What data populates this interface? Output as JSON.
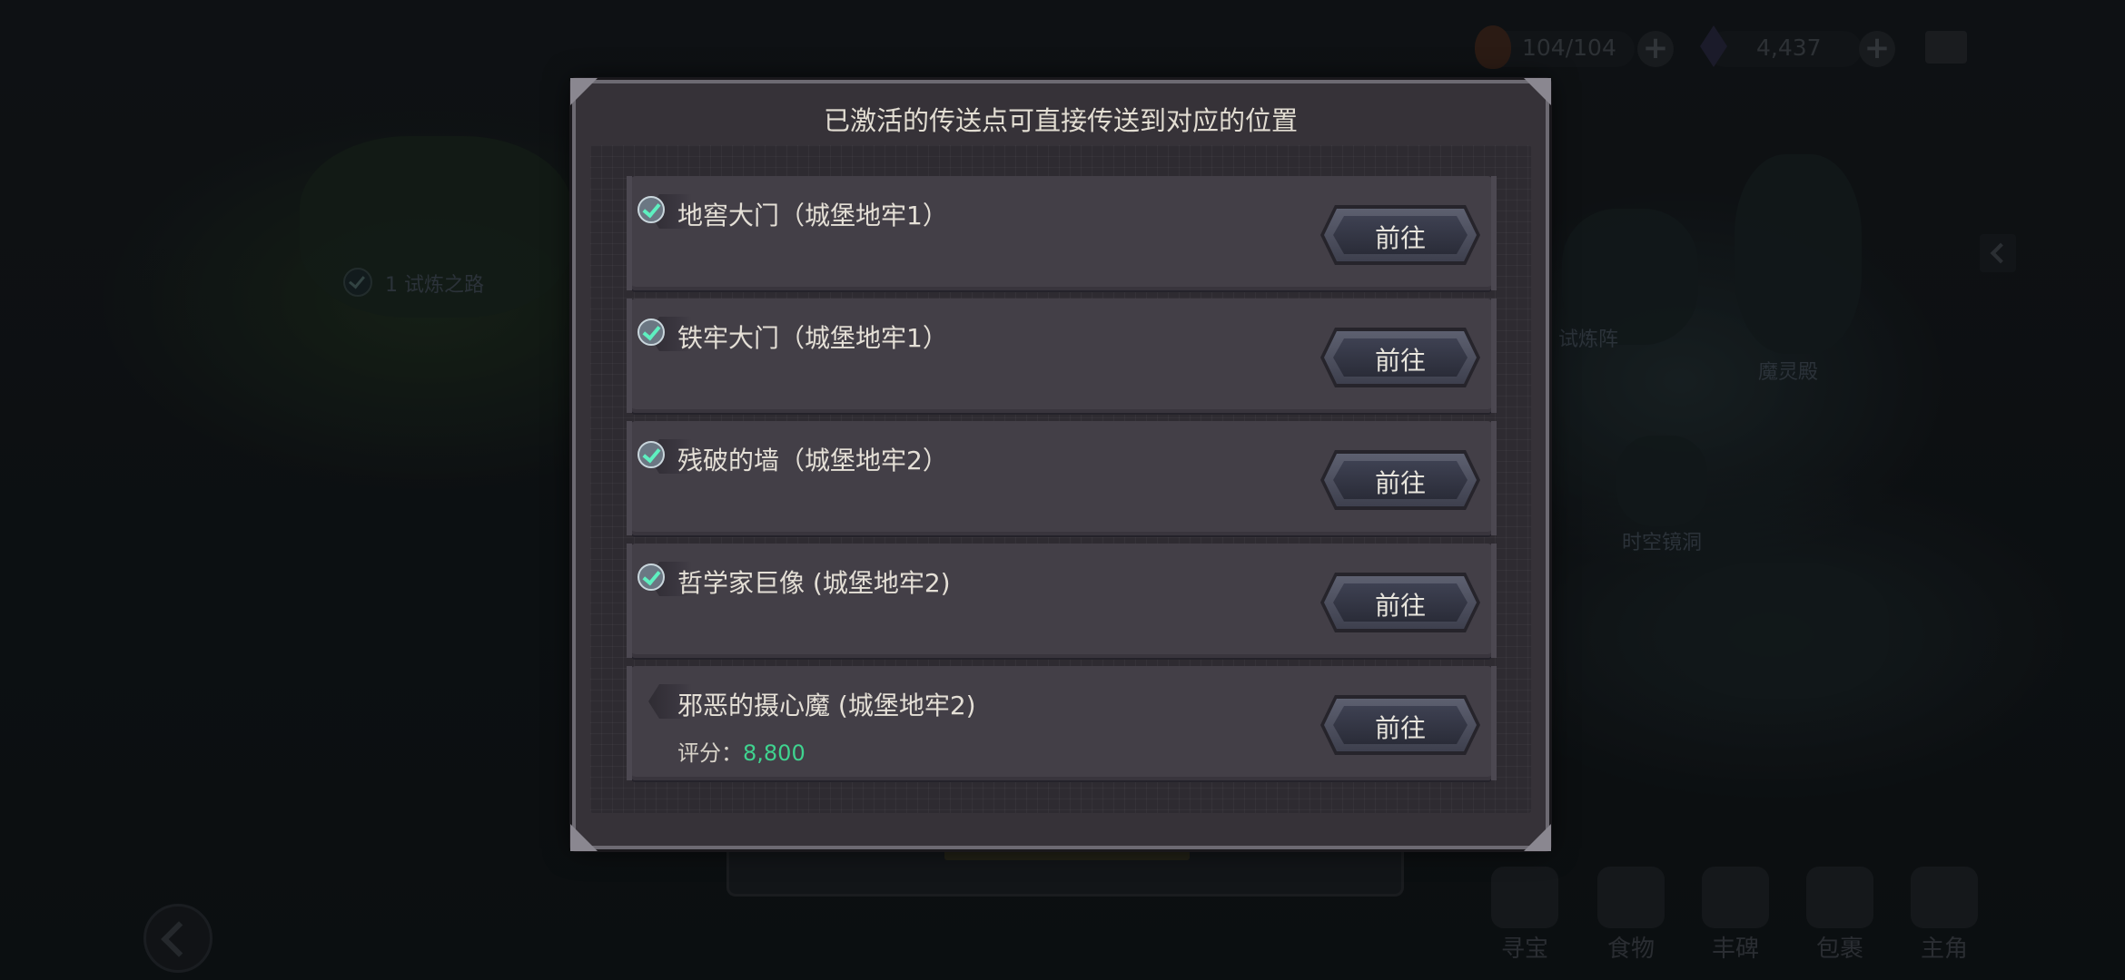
{
  "hud": {
    "stamina": "104/104",
    "gems": "4,437"
  },
  "map": {
    "labels": [
      "1 试炼之路",
      "试炼阵",
      "魔灵殿",
      "时空镜洞"
    ]
  },
  "dialog": {
    "title": "已激活的传送点可直接传送到对应的位置",
    "rows": [
      {
        "name": "地窖大门（城堡地牢1）",
        "activated": true,
        "button": "前往"
      },
      {
        "name": "铁牢大门（城堡地牢1）",
        "activated": true,
        "button": "前往"
      },
      {
        "name": "残破的墙（城堡地牢2）",
        "activated": true,
        "button": "前往"
      },
      {
        "name": "哲学家巨像 (城堡地牢2)",
        "activated": true,
        "button": "前往"
      },
      {
        "name": "邪恶的摄心魔 (城堡地牢2)",
        "activated": false,
        "button": "前往",
        "score_label": "评分：",
        "score_value": "8,800"
      }
    ]
  },
  "bottom_bar": [
    {
      "label": "寻宝"
    },
    {
      "label": "食物"
    },
    {
      "label": "丰碑"
    },
    {
      "label": "包裹"
    },
    {
      "label": "主角"
    }
  ],
  "colors": {
    "score_value": "#3fd38f",
    "check": "#5ef0c0",
    "dialog_bg": "#363238",
    "row_bg": "#433f47"
  }
}
